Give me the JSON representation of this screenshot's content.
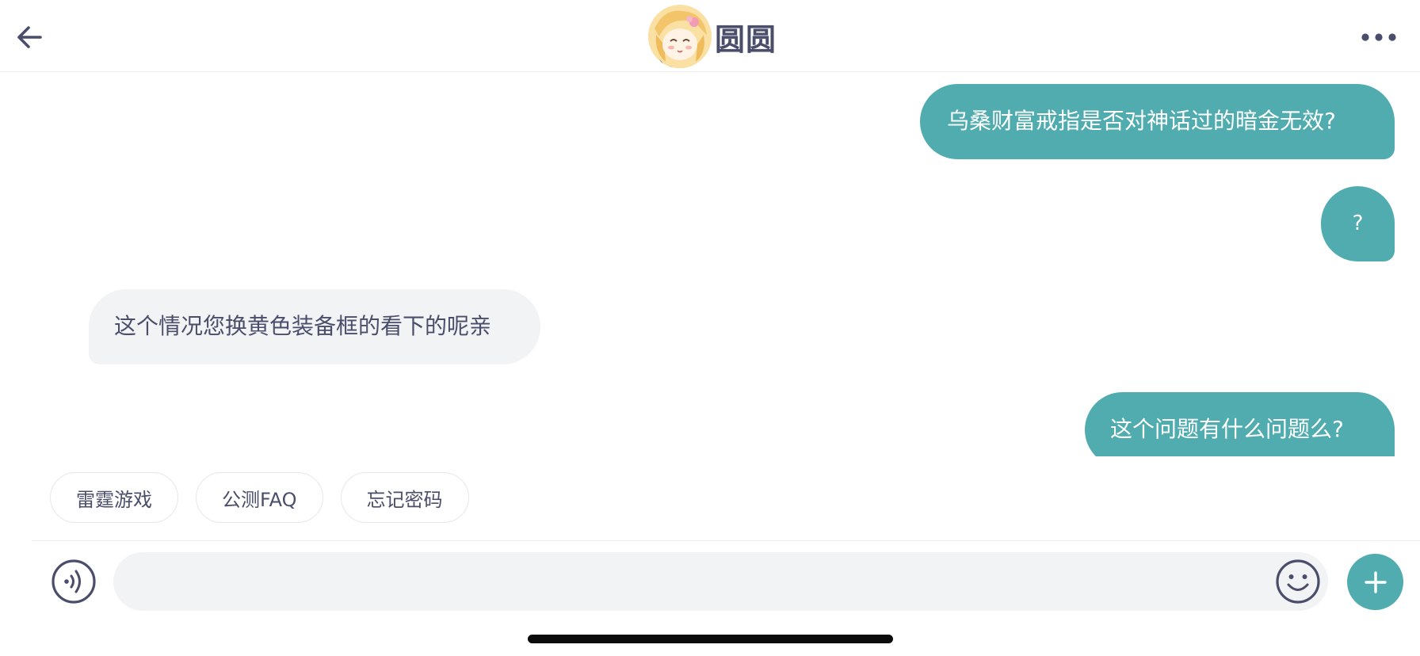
{
  "header": {
    "title": "圆圆",
    "back_icon": "arrow-left-icon",
    "more_icon": "ellipsis-icon",
    "avatar_icon": "avatar"
  },
  "messages": [
    {
      "side": "out",
      "text": "乌桑财富戒指是否对神话过的暗金无效?"
    },
    {
      "side": "out",
      "text": "?"
    },
    {
      "side": "in",
      "text": "这个情况您换黄色装备框的看下的呢亲"
    },
    {
      "side": "out",
      "text": "这个问题有什么问题么?"
    }
  ],
  "quick_replies": [
    "雷霆游戏",
    "公测FAQ",
    "忘记密码"
  ],
  "input": {
    "value": "",
    "placeholder": ""
  },
  "icons": {
    "voice": "voice-icon",
    "emoji": "smiley-icon",
    "plus": "plus-icon"
  },
  "colors": {
    "accent": "#50acae",
    "incoming_bubble": "#f2f3f5",
    "text": "#4a4e6b"
  }
}
